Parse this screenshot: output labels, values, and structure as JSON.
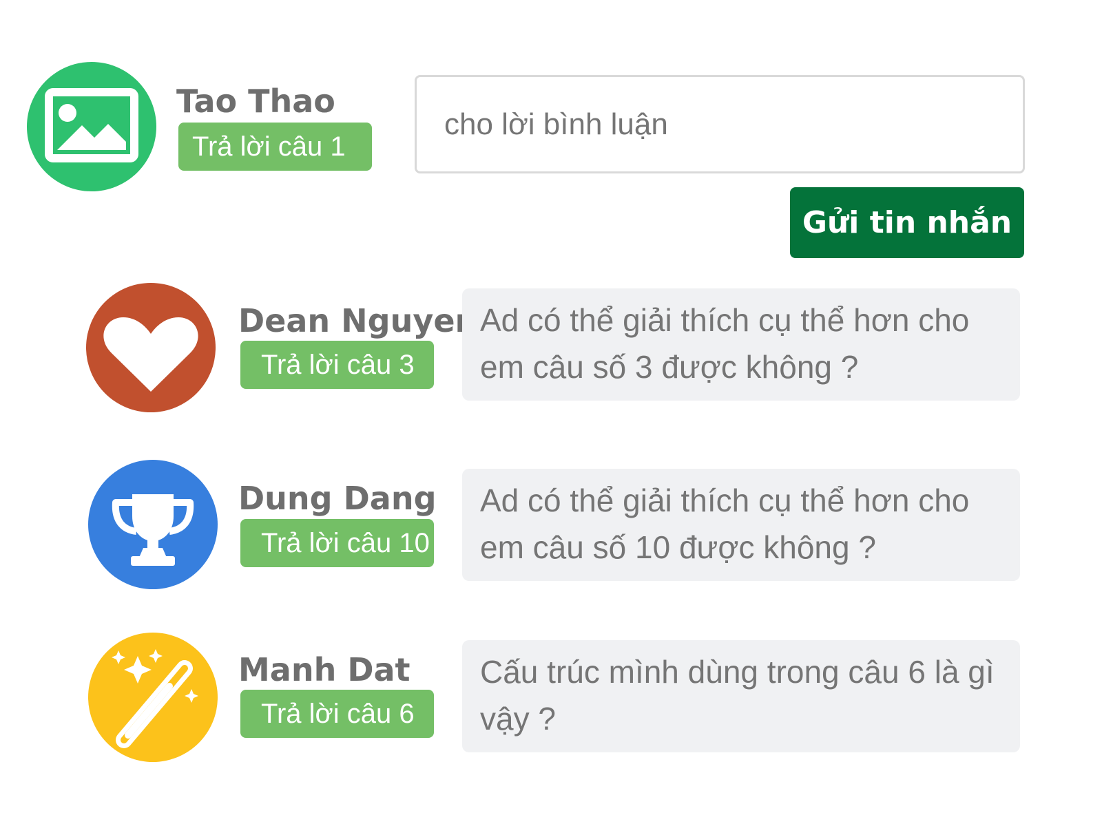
{
  "composer": {
    "user": {
      "name": "Tao Thao",
      "badge": "Trả lời câu 1",
      "avatar_icon": "image-icon",
      "avatar_color": "#2ec16f"
    },
    "input_placeholder": "cho lời bình luận",
    "send_label": "Gửi tin nhắn",
    "send_color": "#04733a"
  },
  "comments": [
    {
      "name": "Dean Nguyen",
      "badge": "Trả lời câu 3",
      "avatar_icon": "heart-icon",
      "avatar_color": "#c1502e",
      "text": "Ad có thể giải thích cụ thể hơn cho em câu số 3 được không ?"
    },
    {
      "name": "Dung Dang",
      "badge": "Trả lời câu 10",
      "avatar_icon": "trophy-icon",
      "avatar_color": "#377fde",
      "text": "Ad có thể giải thích cụ thể hơn cho em câu số 10 được không ?"
    },
    {
      "name": "Manh Dat",
      "badge": "Trả lời câu 6",
      "avatar_icon": "magic-wand-icon",
      "avatar_color": "#fcc21b",
      "text": "Cấu trúc mình dùng trong câu 6 là gì vậy ?"
    }
  ],
  "colors": {
    "badge": "#74bf66",
    "bubble": "#f0f1f3",
    "text": "#757575",
    "name": "#6e6e6e"
  }
}
